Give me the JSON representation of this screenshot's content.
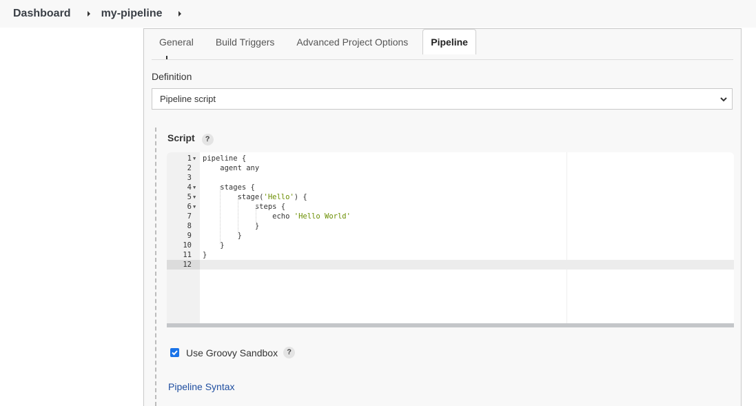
{
  "breadcrumb": {
    "items": [
      {
        "label": "Dashboard"
      },
      {
        "label": "my-pipeline"
      }
    ]
  },
  "tabs": [
    {
      "label": "General",
      "active": false
    },
    {
      "label": "Build Triggers",
      "active": false
    },
    {
      "label": "Advanced Project Options",
      "active": false
    },
    {
      "label": "Pipeline",
      "active": true
    }
  ],
  "definition": {
    "label": "Definition",
    "selected": "Pipeline script"
  },
  "script": {
    "label": "Script",
    "help_icon": "?",
    "lines": [
      {
        "num": "1",
        "fold": true,
        "text": "pipeline {"
      },
      {
        "num": "2",
        "fold": false,
        "text": "    agent any"
      },
      {
        "num": "3",
        "fold": false,
        "text": ""
      },
      {
        "num": "4",
        "fold": true,
        "text": "    stages {"
      },
      {
        "num": "5",
        "fold": true,
        "pre": "        stage(",
        "str": "'Hello'",
        "post": ") {"
      },
      {
        "num": "6",
        "fold": true,
        "text": "            steps {"
      },
      {
        "num": "7",
        "fold": false,
        "pre": "                echo ",
        "str": "'Hello World'",
        "post": ""
      },
      {
        "num": "8",
        "fold": false,
        "text": "            }"
      },
      {
        "num": "9",
        "fold": false,
        "text": "        }"
      },
      {
        "num": "10",
        "fold": false,
        "text": "    }"
      },
      {
        "num": "11",
        "fold": false,
        "text": "}"
      },
      {
        "num": "12",
        "fold": false,
        "text": "",
        "active": true
      }
    ]
  },
  "sandbox": {
    "label": "Use Groovy Sandbox",
    "checked": true,
    "help_icon": "?"
  },
  "pipeline_syntax_link": "Pipeline Syntax",
  "colors": {
    "link": "#1f4ea0",
    "checkbox": "#1a73e8",
    "string": "#6a8e00"
  }
}
